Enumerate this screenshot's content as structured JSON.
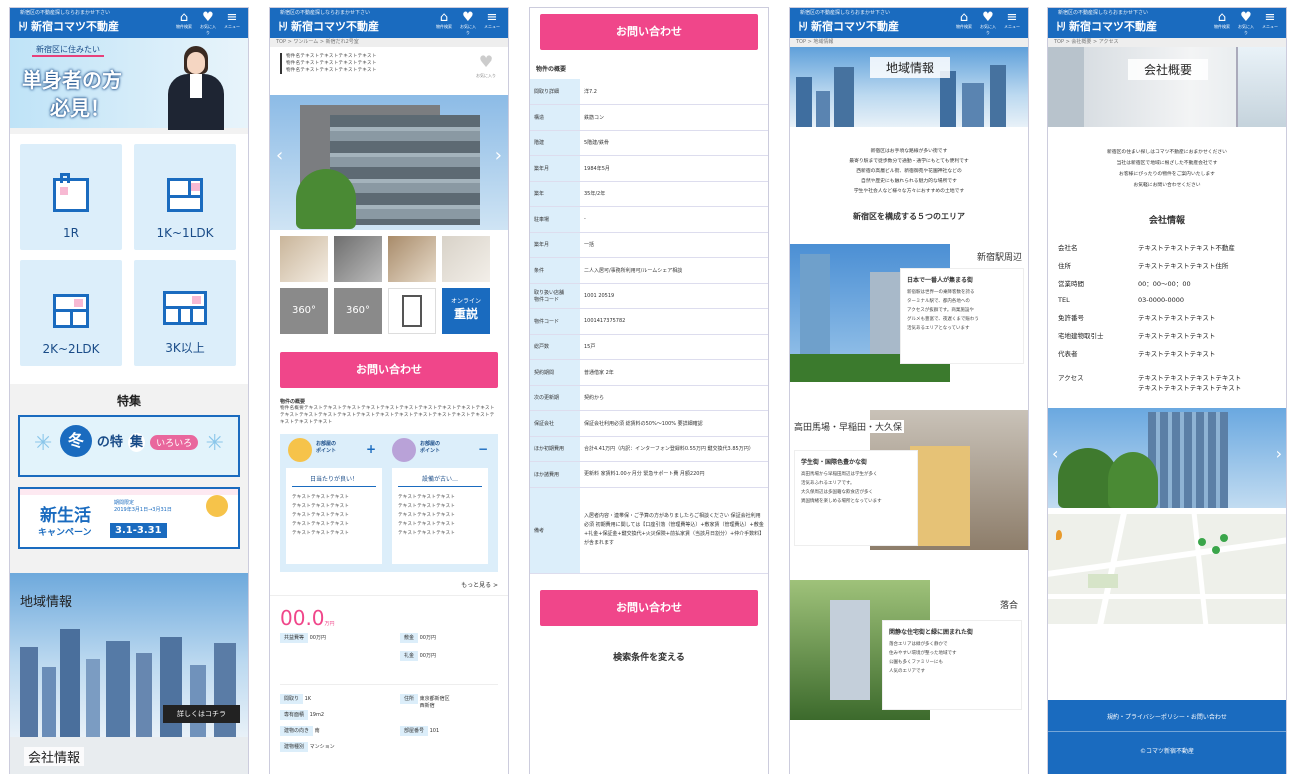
{
  "common": {
    "tagline": "新宿区の不動産探しならおまかせ下さい",
    "logo_mark": "ﾄﾘ",
    "logo_text": "新宿コマツ不動産",
    "icon_labels": [
      "物件検索",
      "お気に入り",
      "メニュー"
    ]
  },
  "p1": {
    "hero_pill": "新宿区に住みたい",
    "hero_title_1": "単身者の方",
    "hero_title_2": "必見！",
    "cards": [
      "1R",
      "1K~1LDK",
      "2K~2LDK",
      "3K以上"
    ],
    "feature_title": "特集",
    "banner1_a": "冬",
    "banner1_b": "の特",
    "banner1_c": "集",
    "banner1_d": "いろいろ",
    "banner2_title_1": "新生活",
    "banner2_title_2": "キャンペーン",
    "banner2_dates": "3.1-3.31",
    "banner2_note": "期間限定\n2019年3月1日→3月31日",
    "region_title": "地域情報",
    "region_btn": "詳しくはコチラ",
    "company_title": "会社情報"
  },
  "p2": {
    "breadcrumb": "TOP > ワンルーム > 新宿だれ2号室",
    "lead": "物件名テキストテキストテキストテキスト\n物件名テキストテキストテキストテキスト\n物件名テキストテキストテキストテキスト",
    "fav": "お気に入り",
    "badge_360": "360°",
    "online_1": "オンライン",
    "online_2": "重説",
    "inquiry": "お問い合わせ",
    "outline_head": "物件の概要",
    "outline_text": "物件名概要テキストテキストテキストテキストテキストテキストテキストテキストテキストテキストテキストテキストテキストテキストテキストテキストテキストテキストテキストテキストテキストテキストテキストテキスト",
    "point_good_title": "お部屋の\nポイント",
    "point_good_sign": "+",
    "point_bad_sign": "−",
    "point_good_head": "日当たりが良い！",
    "point_bad_head": "設備が古い…",
    "point_body": "テキストテキストテキスト\nテキストテキストテキスト\nテキストテキストテキスト\nテキストテキストテキスト\nテキストテキストテキスト",
    "more": "もっと見る >",
    "price": "00.0",
    "price_unit": "万円",
    "fees": [
      [
        "共益費等",
        "00万円"
      ],
      [
        "敷金",
        "00万円"
      ],
      [
        "礼金",
        "00万円"
      ]
    ],
    "specs": [
      [
        "間取り",
        "1K"
      ],
      [
        "住所",
        "東京都新宿区\n西新宿"
      ],
      [
        "専有面積",
        "19m2"
      ],
      [
        "建物の向き",
        "南"
      ],
      [
        "部屋番号",
        "101"
      ],
      [
        "建物種別",
        "マンション"
      ]
    ]
  },
  "p3": {
    "inquiry_top": "お問い合わせ",
    "section": "物件の概要",
    "rows": [
      [
        "間取り詳細",
        "洋7.2"
      ],
      [
        "構造",
        "鉄筋コン"
      ],
      [
        "階建",
        "5階建/鉄骨"
      ],
      [
        "築年月",
        "1984年5月"
      ],
      [
        "築年",
        "35年/2年"
      ],
      [
        "駐車場",
        "-"
      ],
      [
        "築年月",
        "一括"
      ],
      [
        "条件",
        "二人入居可/事務所利用可/ルームシェア相談"
      ],
      [
        "取り扱い店舗\n物件コード",
        "1001 20519"
      ],
      [
        "物件コード",
        "1001417375782"
      ],
      [
        "総戸数",
        "15戸"
      ],
      [
        "契約期間",
        "普通借家 2年"
      ],
      [
        "次の更新期",
        "契約から"
      ],
      [
        "保証会社",
        "保証会社利用必須 総賃料の50%～100% 要詳細確認"
      ],
      [
        "ほか初期費用",
        "合計4.41万円（内訳：インターフォン登録料0.55万円 鍵交換代3.85万円）"
      ],
      [
        "ほか諸費用",
        "更新料 家賃料1.00ヶ月分 緊急サポート費 月額220円"
      ],
      [
        "備考",
        "入居者内容・連帯保・ご予算の方がありましたらご相談ください 保証会社利用必須 初期費用に関しては【口座引落（管理費等込）+敷家賃（管理費込）+敷金+礼金+保証金+鍵交換代+火災保険+前払家賃（当該月日割分）+仲介手数料】が含まれます"
      ]
    ],
    "inquiry_bottom": "お問い合わせ",
    "change_search": "検索条件を変える"
  },
  "p4": {
    "breadcrumb": "TOP > 地域情報",
    "hero": "地域情報",
    "intro": "新宿区はお手頃な路線が多い街です\n最寄り駅まで徒歩数分で通勤・通学にもとても便利です\n西新宿の高層ビル街、新宿御苑や花園神社などの\n自然や歴史にも触れられる魅力的な場所です\n学生や社会人など様々な方々におすすめの土地です",
    "areas_title": "新宿区を構成する５つのエリア",
    "area1": "新宿駅周辺",
    "area1_head": "日本で一番人が集まる街",
    "area1_body": "新宿駅は世界一の乗降客数を誇る\nターミナル駅で、都内各地への\nアクセスが抜群です。商業施設や\nグルメも豊富で、夜遅くまで賑わう\n活気あるエリアとなっています",
    "area2": "高田馬場・早稲田・大久保",
    "area2_head": "学生街・国際色豊かな街",
    "area2_body": "高田馬場から早稲田周辺は学生が多く\n活気あふれるエリアです。\n大久保周辺は多国籍な飲食店が多く\n異国情緒を楽しめる場所となっています",
    "area3": "落合",
    "area3_head": "閑静な住宅街と緑に囲まれた街",
    "area3_body": "落合エリアは緑が多く静かで\n住みやすい環境が整った地域です\n公園も多くファミリーにも\n人気のエリアです"
  },
  "p5": {
    "breadcrumb": "TOP > 会社概要 > アクセス",
    "hero": "会社概要",
    "intro": "新宿区の住まい探しはコマツ不動産におまかせください\n当社は新宿区で地域に根ざした不動産会社です\nお客様にぴったりの物件をご案内いたします\nお気軽にお問い合わせください",
    "info_title": "会社情報",
    "rows": [
      [
        "会社名",
        "テキストテキストテキスト不動産"
      ],
      [
        "住所",
        "テキストテキストテキスト住所"
      ],
      [
        "営業時間",
        "00：00〜00：00"
      ],
      [
        "TEL",
        "03-0000-0000"
      ],
      [
        "免許番号",
        "テキストテキストテキスト"
      ],
      [
        "宅地建物取引士",
        "テキストテキストテキスト"
      ],
      [
        "代表者",
        "テキストテキストテキスト"
      ],
      [
        "アクセス",
        "テキストテキストテキストテキスト\nテキストテキストテキストテキスト"
      ]
    ],
    "footer_links": "規約・プライバシーポリシー・お問い合わせ",
    "copyright": "©コマツ新宿不動産"
  }
}
